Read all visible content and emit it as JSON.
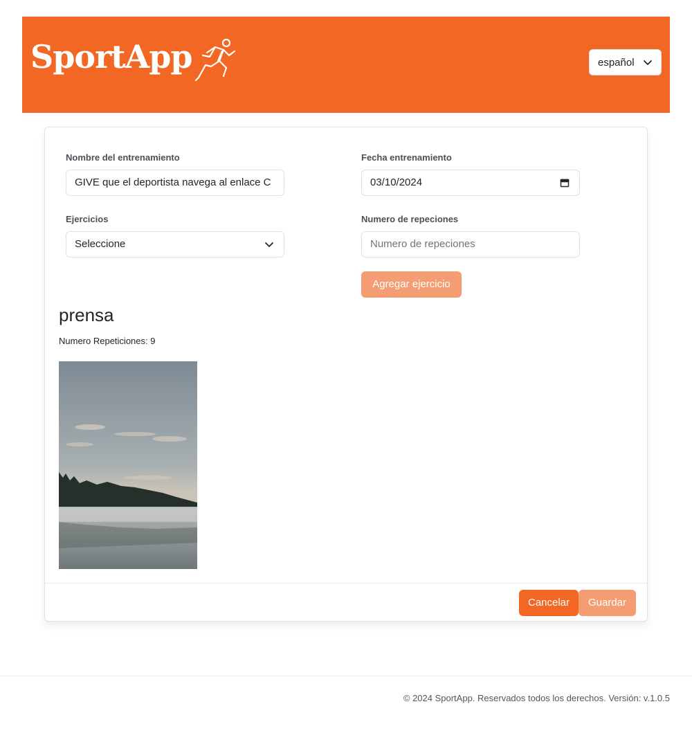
{
  "header": {
    "logo_text": "SportApp",
    "logo_icon": "runner-icon",
    "language": "español",
    "brand_color": "#f26724"
  },
  "form": {
    "name_label": "Nombre del entrenamiento",
    "name_value": "GIVE que el deportista navega al enlace C",
    "date_label": "Fecha entrenamiento",
    "date_value": "03/10/2024",
    "exercises_label": "Ejercicios",
    "exercises_value": "Seleccione",
    "reps_label": "Numero de repeciones",
    "reps_placeholder": "Numero de repeciones",
    "add_button": "Agregar ejercicio"
  },
  "exercise": {
    "title": "prensa",
    "reps_text": "Numero Repeticiones: 9"
  },
  "actions": {
    "cancel": "Cancelar",
    "save": "Guardar"
  },
  "footer": {
    "text": "© 2024 SportApp. Reservados todos los derechos. Versión: v.1.0.5"
  }
}
